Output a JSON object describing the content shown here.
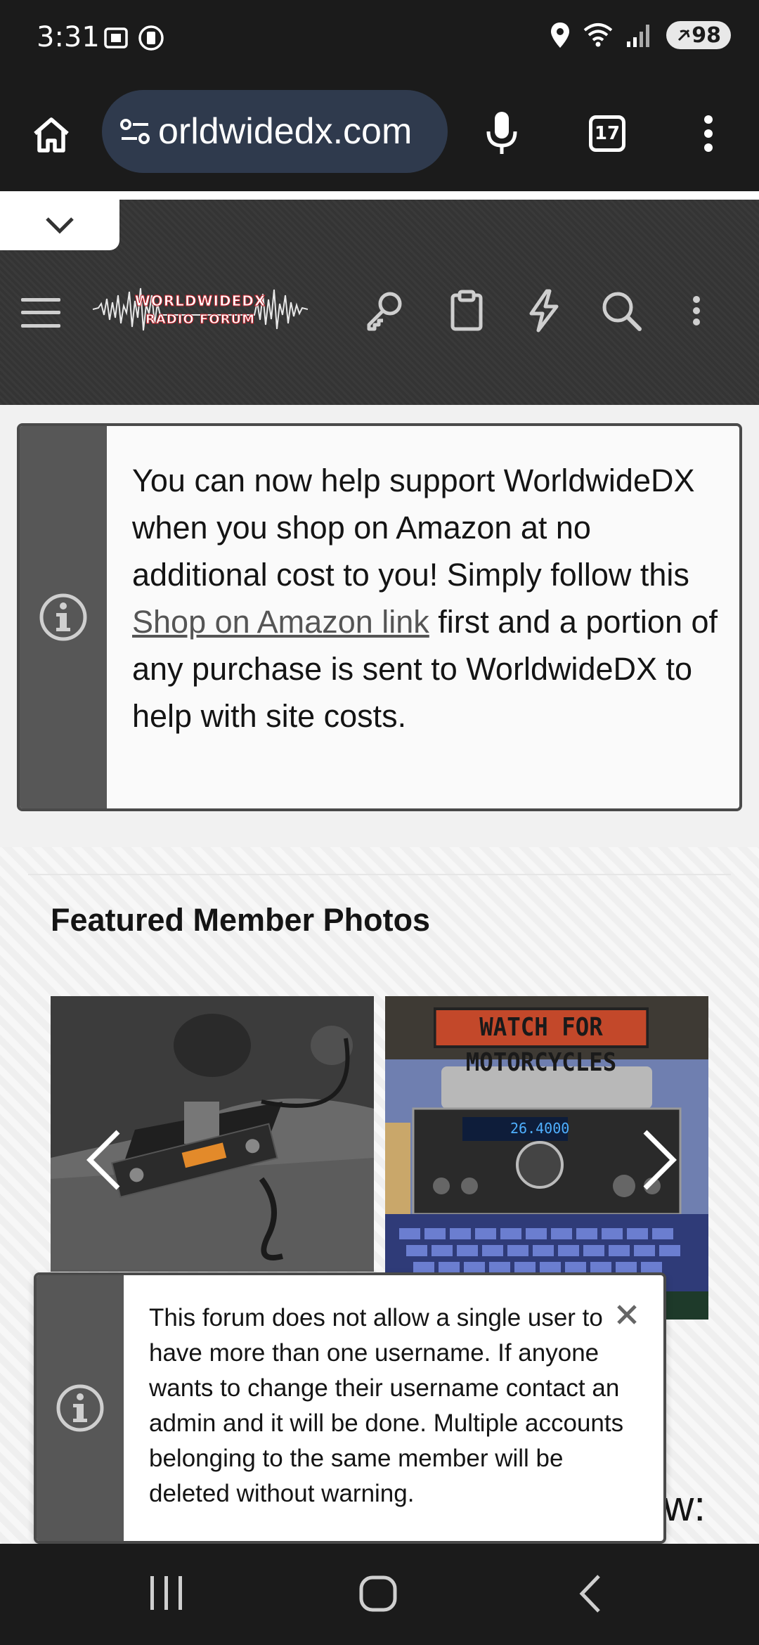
{
  "status_bar": {
    "time": "3:31",
    "battery": "98"
  },
  "browser": {
    "url": "orldwidedx.com",
    "tab_count": "17"
  },
  "site": {
    "logo_line1": "WORLDWIDEDX",
    "logo_line2": "RADIO FORUM"
  },
  "notice_amazon": {
    "text_before": "You can now help support WorldwideDX when you shop on Amazon at no additional cost to you! Simply follow this ",
    "link": "Shop on Amazon link",
    "text_after": " first and a portion of any purchase is sent to WorldwideDX to help with site costs."
  },
  "featured": {
    "title": "Featured Member Photos",
    "photo2_sign": "WATCH FOR MOTORCYCLES",
    "radio_display": "26.4000"
  },
  "notice_username": {
    "text": "This forum does not allow a single user to have more than one username. If anyone wants to change their username contact an admin and it will be done. Multiple accounts belonging to the same member will be deleted without warning."
  },
  "peek_text": "w:",
  "colors": {
    "dark": "#1b1b1b",
    "url_pill": "#2f3a4d",
    "notice_side": "#575757"
  }
}
